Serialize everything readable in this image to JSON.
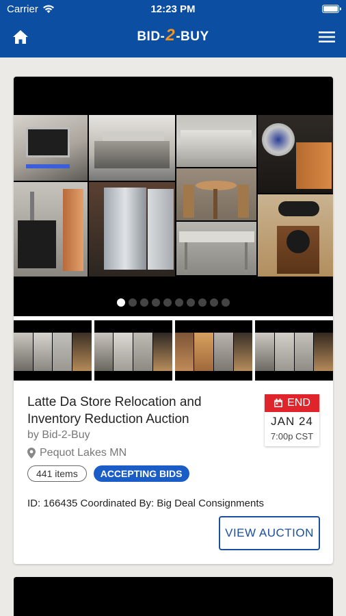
{
  "status_bar": {
    "carrier": "Carrier",
    "time": "12:23 PM"
  },
  "header": {
    "logo_left": "BID-",
    "logo_mid": "2",
    "logo_right": "-BUY"
  },
  "icons": {
    "home": "home-icon",
    "menu": "hamburger-menu-icon",
    "wifi": "wifi-icon",
    "battery": "battery-icon",
    "calendar": "calendar-icon",
    "location": "location-pin-icon"
  },
  "colors": {
    "header": "#0b4ea2",
    "accent": "#1a5dc6",
    "end_red": "#e0242b",
    "logo_two": "#f7941d"
  },
  "auction": {
    "title": "Latte Da Store Relocation and Inventory Reduction Auction",
    "seller": "by Bid-2-Buy",
    "location": "Pequot Lakes MN",
    "item_count": "441 items",
    "status": "ACCEPTING BIDS",
    "meta": "ID: 166435 Coordinated By: Big Deal Consignments",
    "end_label": "END",
    "end_date_month": "JAN",
    "end_date_day": "24",
    "end_time": "7:00p CST",
    "view_button": "VIEW AUCTION"
  },
  "carousel": {
    "total_slides": 10,
    "active_slide": 1
  }
}
